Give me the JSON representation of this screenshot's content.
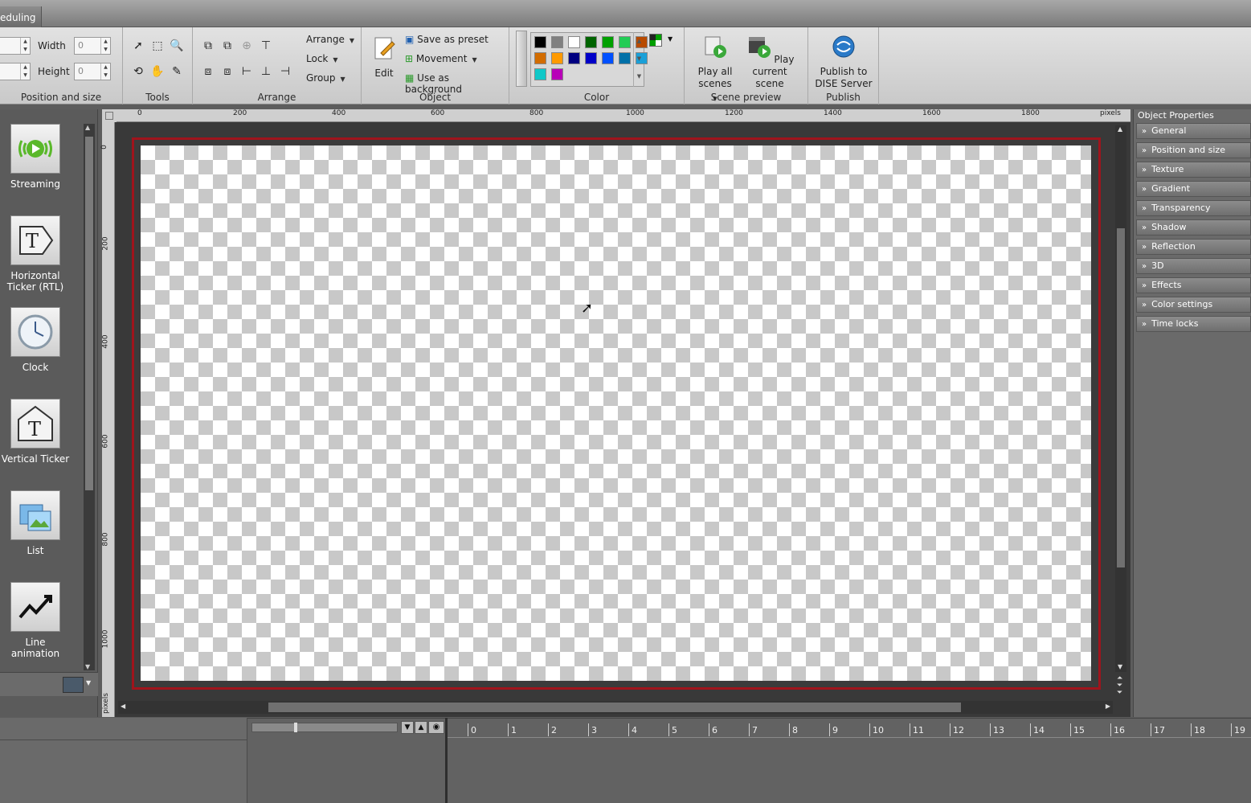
{
  "window": {
    "active_tab": "eduling"
  },
  "ribbon": {
    "position_size": {
      "label": "Position and size",
      "width_label": "Width",
      "height_label": "Height",
      "width_value": "0",
      "height_value": "0"
    },
    "tools": {
      "label": "Tools"
    },
    "arrange": {
      "label": "Arrange",
      "menu": [
        "Arrange",
        "Lock",
        "Group"
      ]
    },
    "object": {
      "label": "Object",
      "edit": "Edit",
      "save_preset": "Save as preset",
      "movement": "Movement",
      "use_background": "Use as background"
    },
    "color": {
      "label": "Color",
      "swatches": [
        "#000000",
        "#808080",
        "#ffffff",
        "#006400",
        "#00a000",
        "#22cc55",
        "#b84a00",
        "#d26c00",
        "#ff9a00",
        "#000080",
        "#0000c8",
        "#0050ff",
        "#0070a8",
        "#1aa0d8",
        "#10c8c8",
        "#b800b8"
      ]
    },
    "scene_preview": {
      "label": "Scene preview",
      "play_all": [
        "Play all",
        "scenes"
      ],
      "play_current": [
        "Play current",
        "scene"
      ]
    },
    "publish": {
      "label": "Publish",
      "publish_dise": [
        "Publish to",
        "DISE Server"
      ]
    }
  },
  "tools_panel": {
    "items": [
      {
        "label": "Streaming",
        "icon": "streaming-icon"
      },
      {
        "label": "Horizontal Ticker (RTL)",
        "icon": "ticker-rtl-icon"
      },
      {
        "label": "Clock",
        "icon": "clock-icon"
      },
      {
        "label": "Vertical Ticker",
        "icon": "vertical-ticker-icon"
      },
      {
        "label": "List",
        "icon": "list-icon"
      },
      {
        "label": "Line animation",
        "icon": "line-animation-icon"
      }
    ]
  },
  "rulers": {
    "unit": "pixels",
    "h_ticks": [
      "0",
      "200",
      "400",
      "600",
      "800",
      "1000",
      "1200",
      "1400",
      "1600",
      "1800"
    ],
    "v_ticks": [
      "0",
      "200",
      "400",
      "600",
      "800",
      "1000"
    ],
    "v_unit": "pixels"
  },
  "properties": {
    "title": "Object Properties",
    "items": [
      "General",
      "Position and size",
      "Texture",
      "Gradient",
      "Transparency",
      "Shadow",
      "Reflection",
      "3D",
      "Effects",
      "Color settings",
      "Time locks"
    ]
  },
  "timeline": {
    "ticks": [
      "0",
      "1",
      "2",
      "3",
      "4",
      "5",
      "6",
      "7",
      "8",
      "9",
      "10",
      "11",
      "12",
      "13",
      "14",
      "15",
      "16",
      "17",
      "18",
      "19"
    ]
  }
}
